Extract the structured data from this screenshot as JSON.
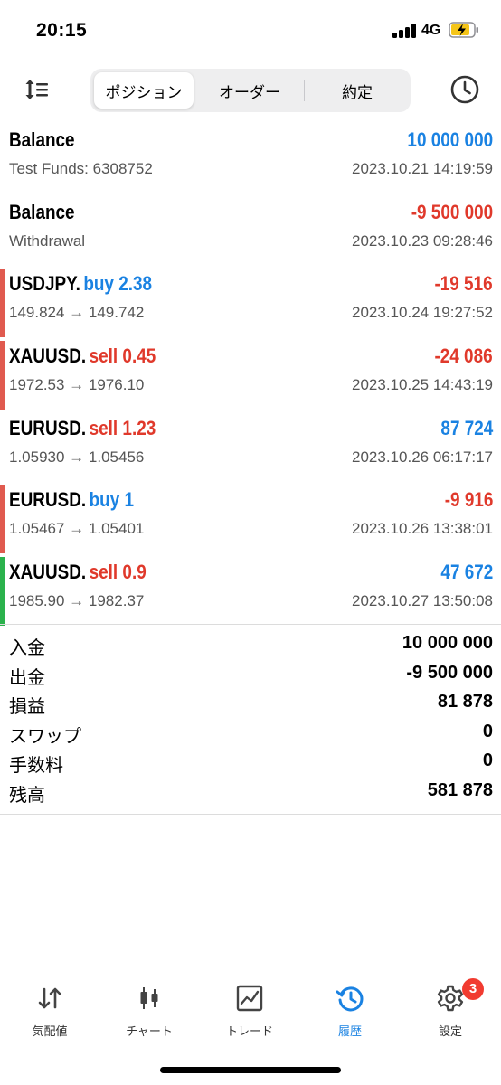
{
  "status_bar": {
    "time": "20:15",
    "network": "4G"
  },
  "toolbar": {
    "segments": [
      {
        "label": "ポジション",
        "active": true
      },
      {
        "label": "オーダー",
        "active": false
      },
      {
        "label": "約定",
        "active": false
      }
    ],
    "icons": {
      "left": "sort-icon",
      "right": "clock-history-icon"
    }
  },
  "history": [
    {
      "symbol": "Balance",
      "side": "",
      "volume": "",
      "subtitle": "Test Funds: 6308752",
      "amount": "10 000 000",
      "amount_color": "blue",
      "time": "2023.10.21 14:19:59",
      "bar_color": ""
    },
    {
      "symbol": "Balance",
      "side": "",
      "volume": "",
      "subtitle": "Withdrawal",
      "amount": "-9 500 000",
      "amount_color": "red",
      "time": "2023.10.23 09:28:46",
      "bar_color": ""
    },
    {
      "symbol": "USDJPY.",
      "side": "buy",
      "volume": "2.38",
      "subtitle": "149.824 → 149.742",
      "amount": "-19 516",
      "amount_color": "red",
      "time": "2023.10.24 19:27:52",
      "bar_color": "#e05a4f"
    },
    {
      "symbol": "XAUUSD.",
      "side": "sell",
      "volume": "0.45",
      "subtitle": "1972.53 → 1976.10",
      "amount": "-24 086",
      "amount_color": "red",
      "time": "2023.10.25 14:43:19",
      "bar_color": "#e05a4f"
    },
    {
      "symbol": "EURUSD.",
      "side": "sell",
      "volume": "1.23",
      "subtitle": "1.05930 → 1.05456",
      "amount": "87 724",
      "amount_color": "blue",
      "time": "2023.10.26 06:17:17",
      "bar_color": ""
    },
    {
      "symbol": "EURUSD.",
      "side": "buy",
      "volume": "1",
      "subtitle": "1.05467 → 1.05401",
      "amount": "-9 916",
      "amount_color": "red",
      "time": "2023.10.26 13:38:01",
      "bar_color": "#e05a4f"
    },
    {
      "symbol": "XAUUSD.",
      "side": "sell",
      "volume": "0.9",
      "subtitle": "1985.90 → 1982.37",
      "amount": "47 672",
      "amount_color": "blue",
      "time": "2023.10.27 13:50:08",
      "bar_color": "#2bb24c"
    }
  ],
  "summary": [
    {
      "label": "入金",
      "value": "10 000 000"
    },
    {
      "label": "出金",
      "value": "-9 500 000"
    },
    {
      "label": "損益",
      "value": "81 878"
    },
    {
      "label": "スワップ",
      "value": "0"
    },
    {
      "label": "手数料",
      "value": "0"
    },
    {
      "label": "残高",
      "value": "581 878"
    }
  ],
  "tabs": [
    {
      "label": "気配値",
      "icon": "quotes-arrows-icon",
      "active": false
    },
    {
      "label": "チャート",
      "icon": "candlestick-chart-icon",
      "active": false
    },
    {
      "label": "トレード",
      "icon": "trade-chart-icon",
      "active": false
    },
    {
      "label": "履歴",
      "icon": "history-icon",
      "active": true
    },
    {
      "label": "設定",
      "icon": "gear-icon",
      "active": false,
      "badge": "3"
    }
  ],
  "colors": {
    "buy": "#1a82e2",
    "sell": "#e0392b",
    "profit": "#1a82e2",
    "loss": "#e0392b",
    "accent": "#1a82e2",
    "badge": "#f13b30"
  }
}
